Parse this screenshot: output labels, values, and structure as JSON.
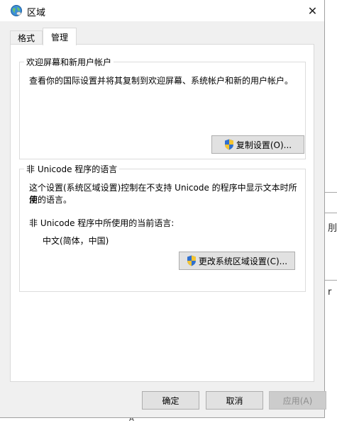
{
  "window": {
    "title": "区域",
    "close_glyph": "✕"
  },
  "tabs": [
    {
      "label": "格式",
      "active": false
    },
    {
      "label": "管理",
      "active": true
    }
  ],
  "welcome_group": {
    "legend": "欢迎屏幕和新用户帐户",
    "description": "查看你的国际设置并将其复制到欢迎屏幕、系统帐户和新的用户帐户。",
    "copy_button": "复制设置(O)..."
  },
  "nonunicode_group": {
    "legend": "非 Unicode 程序的语言",
    "description_line1": "这个设置(系统区域设置)控制在不支持 Unicode 的程序中显示文本时所使",
    "description_line2": "用的语言。",
    "current_label": "非 Unicode 程序中所使用的当前语言:",
    "current_value": "中文(简体，中国)",
    "change_button": "更改系统区域设置(C)..."
  },
  "footer": {
    "ok": "确定",
    "cancel": "取消",
    "apply": "应用(A)"
  },
  "background_chars": {
    "right1": "刖",
    "right2": "r",
    "bottom": "A"
  },
  "colors": {
    "dialog_bg": "#f0f0f0",
    "button_bg": "#e1e1e1",
    "shield_blue": "#2f6fcf",
    "shield_yellow": "#f4c430"
  }
}
